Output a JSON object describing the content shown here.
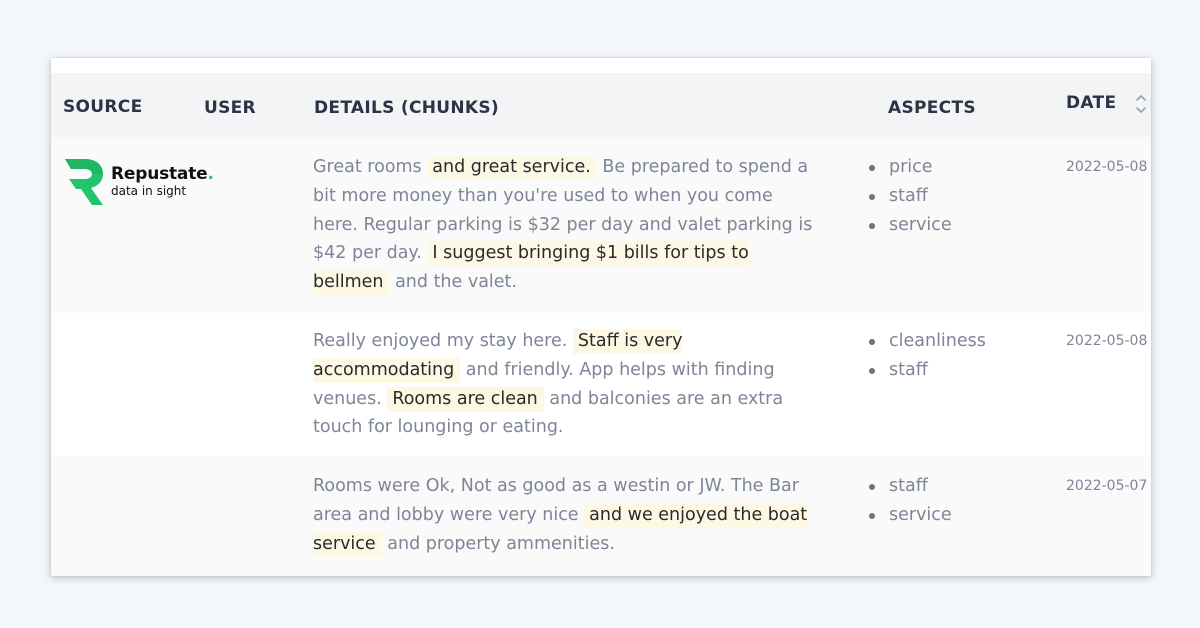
{
  "table": {
    "columns": {
      "source": "SOURCE",
      "user": "USER",
      "details": "DETAILS (CHUNKS)",
      "aspects": "ASPECTS",
      "date": "DATE"
    },
    "sort_icon": "sort-up-down-icon"
  },
  "logo": {
    "name": "Repustate",
    "dot": ".",
    "tagline": "data in sight",
    "color": "#22c56e"
  },
  "colors": {
    "chunk_highlight": "#fcf8e3",
    "header_bg": "#f3f4f6",
    "text_muted": "#7d8596",
    "text_header": "#2d3345"
  },
  "rows": [
    {
      "source": "Repustate",
      "user": "",
      "details": [
        {
          "text": "Great rooms ",
          "chunk": false
        },
        {
          "text": "and great service.",
          "chunk": true
        },
        {
          "text": " Be prepared to spend a bit more money than you're used to when you come here. Regular parking is $32 per day and valet parking is $42 per day. ",
          "chunk": false
        },
        {
          "text": "I suggest bringing $1 bills for tips to bellmen",
          "chunk": true
        },
        {
          "text": " and the valet.",
          "chunk": false
        }
      ],
      "aspects": [
        "price",
        "staff",
        "service"
      ],
      "date": "2022-05-08"
    },
    {
      "source": "",
      "user": "",
      "details": [
        {
          "text": "Really enjoyed my stay here. ",
          "chunk": false
        },
        {
          "text": "Staff is very accommodating",
          "chunk": true
        },
        {
          "text": " and friendly. App helps with finding venues. ",
          "chunk": false
        },
        {
          "text": "Rooms are clean",
          "chunk": true
        },
        {
          "text": " and balconies are an extra touch for lounging or eating.",
          "chunk": false
        }
      ],
      "aspects": [
        "cleanliness",
        "staff"
      ],
      "date": "2022-05-08"
    },
    {
      "source": "",
      "user": "",
      "details": [
        {
          "text": "Rooms were Ok, Not as good as a westin or JW. The Bar area and lobby were very nice ",
          "chunk": false
        },
        {
          "text": "and we enjoyed the boat service",
          "chunk": true
        },
        {
          "text": " and property ammenities.",
          "chunk": false
        }
      ],
      "aspects": [
        "staff",
        "service"
      ],
      "date": "2022-05-07"
    }
  ]
}
